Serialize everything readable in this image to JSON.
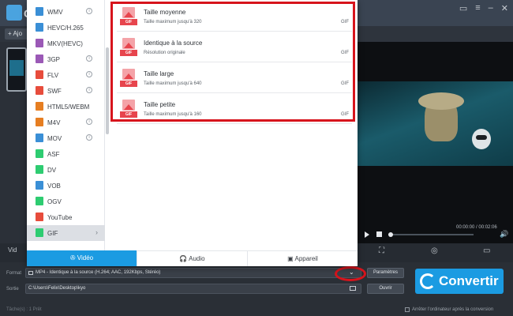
{
  "app": {
    "title_fragment": "C",
    "add_button_label": "+ Ajo"
  },
  "format_list": [
    {
      "label": "WMV",
      "icon": "wmv-icon",
      "color": "#3a8fd6",
      "info": true
    },
    {
      "label": "HEVC/H.265",
      "icon": "hevc-icon",
      "color": "#3a8fd6",
      "info": false
    },
    {
      "label": "MKV(HEVC)",
      "icon": "mkv-hevc-icon",
      "color": "#9b59b6",
      "info": false
    },
    {
      "label": "3GP",
      "icon": "3gp-icon",
      "color": "#9b59b6",
      "info": true
    },
    {
      "label": "FLV",
      "icon": "flv-icon",
      "color": "#e74c3c",
      "info": true
    },
    {
      "label": "SWF",
      "icon": "swf-icon",
      "color": "#e74c3c",
      "info": true
    },
    {
      "label": "HTML5/WEBM",
      "icon": "html5-icon",
      "color": "#e67e22",
      "info": false
    },
    {
      "label": "M4V",
      "icon": "m4v-icon",
      "color": "#e67e22",
      "info": true
    },
    {
      "label": "MOV",
      "icon": "mov-icon",
      "color": "#3a8fd6",
      "info": true
    },
    {
      "label": "ASF",
      "icon": "asf-icon",
      "color": "#2ecc71",
      "info": false
    },
    {
      "label": "DV",
      "icon": "dv-icon",
      "color": "#2ecc71",
      "info": false
    },
    {
      "label": "VOB",
      "icon": "vob-icon",
      "color": "#3a8fd6",
      "info": false
    },
    {
      "label": "OGV",
      "icon": "ogv-icon",
      "color": "#2ecc71",
      "info": false
    },
    {
      "label": "YouTube",
      "icon": "youtube-icon",
      "color": "#e74c3c",
      "info": false
    },
    {
      "label": "GIF",
      "icon": "gif-icon",
      "color": "#2ecc71",
      "info": false,
      "selected": true
    }
  ],
  "resolutions": [
    {
      "title": "Taille moyenne",
      "subtitle": "Taille maximum jusqu'à 320",
      "format": "GIF"
    },
    {
      "title": "Identique à la source",
      "subtitle": "Résolution originale",
      "format": "GIF"
    },
    {
      "title": "Taille large",
      "subtitle": "Taille maximum jusqu'à 640",
      "format": "GIF"
    },
    {
      "title": "Taille petite",
      "subtitle": "Taille maximum jusqu'à 160",
      "format": "GIF"
    }
  ],
  "tabs": [
    {
      "label": "Vidéo",
      "icon": "film-reel-icon",
      "active": true
    },
    {
      "label": "Audio",
      "icon": "headphones-icon",
      "active": false
    },
    {
      "label": "Appareil",
      "icon": "device-icon",
      "active": false
    }
  ],
  "player": {
    "time": "00:00:00 / 00:02:06",
    "progress_fraction": 0.02
  },
  "bottom": {
    "partial_video_label": "Vid",
    "format_label": "Format",
    "format_value": "MP4 - Identique à la source (H.264; AAC, 192Kbps, Stéréo)",
    "params_button": "Paramètres",
    "output_label": "Sortie",
    "output_value": "C:\\Users\\Felix\\Desktop\\kyo",
    "open_button": "Ouvrir",
    "convert_button": "Convertir",
    "shutdown_label": "Arrêter l'ordinateur après la conversion",
    "status_left": "Tâche(s) : 1    Prêt"
  },
  "colors": {
    "accent": "#1b9be2",
    "highlight_red": "#d7141c",
    "gif_red": "#e7454d"
  }
}
